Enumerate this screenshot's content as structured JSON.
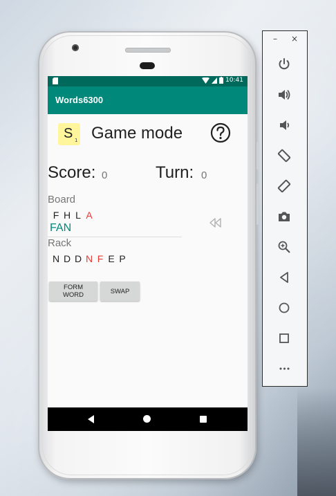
{
  "app": {
    "title": "Words6300",
    "status_time": "10:41"
  },
  "header": {
    "tile_letter": "S",
    "tile_score": "1",
    "mode_title": "Game mode",
    "help_icon": "help-circle-icon"
  },
  "scoreboard": {
    "score_label": "Score:",
    "score_value": "0",
    "turn_label": "Turn:",
    "turn_value": "0"
  },
  "board": {
    "label": "Board",
    "letters": [
      {
        "char": "F",
        "highlight": false
      },
      {
        "char": "H",
        "highlight": false
      },
      {
        "char": "L",
        "highlight": false
      },
      {
        "char": "A",
        "highlight": true
      }
    ],
    "word": "FAN",
    "rewind_icon": "rewind-icon"
  },
  "rack": {
    "label": "Rack",
    "letters": [
      {
        "char": "N",
        "highlight": false
      },
      {
        "char": "D",
        "highlight": false
      },
      {
        "char": "D",
        "highlight": false
      },
      {
        "char": "N",
        "highlight": true
      },
      {
        "char": "F",
        "highlight": true
      },
      {
        "char": "E",
        "highlight": false
      },
      {
        "char": "P",
        "highlight": false
      }
    ]
  },
  "actions": {
    "form_word": "FORM WORD",
    "swap": "SWAP"
  },
  "navbar": {
    "back_icon": "back-triangle-icon",
    "home_icon": "home-circle-icon",
    "recents_icon": "recents-square-icon"
  },
  "emulator": {
    "minimize": "–",
    "close": "×",
    "tools": [
      "power-icon",
      "volume-up-icon",
      "volume-down-icon",
      "rotate-left-icon",
      "rotate-right-icon",
      "camera-icon",
      "zoom-icon",
      "back-icon",
      "home-icon",
      "overview-icon",
      "more-icon"
    ],
    "more_label": "•••"
  },
  "colors": {
    "status_bar": "#00695c",
    "app_bar": "#00897b",
    "tile": "#fff59d",
    "highlight_letter": "#e53935",
    "word": "#00897b"
  }
}
